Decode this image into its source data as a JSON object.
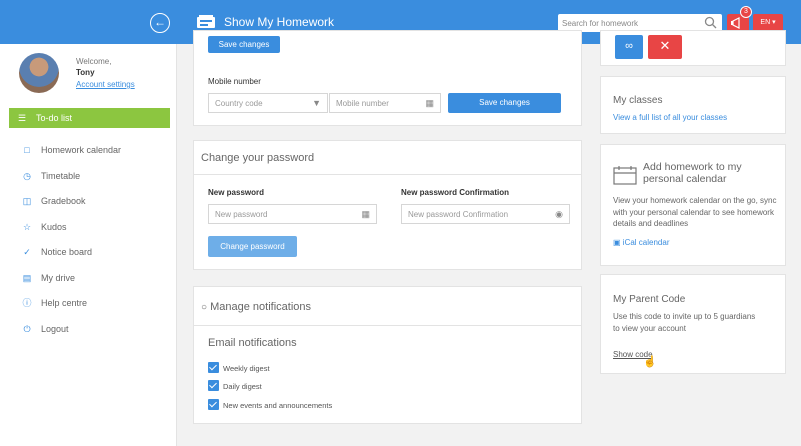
{
  "header": {
    "brand_title": "Show My Homework",
    "search_placeholder": "Search for homework",
    "notification_count": "3",
    "language": "EN ▾"
  },
  "sidebar": {
    "welcome": "Welcome,",
    "user_name": "Tony",
    "account_settings": "Account settings",
    "items": [
      {
        "label": "To-do list",
        "icon": "list-icon"
      },
      {
        "label": "Homework calendar",
        "icon": "calendar-icon"
      },
      {
        "label": "Timetable",
        "icon": "clock-icon"
      },
      {
        "label": "Gradebook",
        "icon": "book-icon"
      },
      {
        "label": "Kudos",
        "icon": "star-icon"
      },
      {
        "label": "Notice board",
        "icon": "pin-icon"
      },
      {
        "label": "My drive",
        "icon": "drive-icon"
      },
      {
        "label": "Help centre",
        "icon": "help-icon"
      },
      {
        "label": "Logout",
        "icon": "power-icon"
      }
    ]
  },
  "profile": {
    "save_changes_top": "Save changes",
    "mobile_label": "Mobile number",
    "country_placeholder": "Country code",
    "mobile_placeholder": "Mobile number",
    "save_changes": "Save changes"
  },
  "password": {
    "title": "Change your password",
    "new_label": "New password",
    "confirm_label": "New password Confirmation",
    "new_placeholder": "New password",
    "confirm_placeholder": "New password Confirmation",
    "button": "Change password"
  },
  "notifications": {
    "title": "Manage notifications",
    "email_title": "Email notifications",
    "options": [
      {
        "label": "Weekly digest",
        "checked": true
      },
      {
        "label": "Daily digest",
        "checked": true
      },
      {
        "label": "New events and announcements",
        "checked": true
      }
    ]
  },
  "right": {
    "classes_title": "My classes",
    "classes_link": "View a full list of all your classes",
    "cal_title": "Add homework to my personal calendar",
    "cal_text": "View your homework calendar on the go, sync with your personal calendar to see homework details and deadlines",
    "cal_link": "iCal calendar",
    "parent_title": "My Parent Code",
    "parent_text": "Use this code to invite up to 5 guardians to view your account",
    "parent_link": "Show code"
  },
  "colors": {
    "primary": "#3a8dde",
    "active_nav": "#8cc640",
    "danger": "#e84545"
  }
}
